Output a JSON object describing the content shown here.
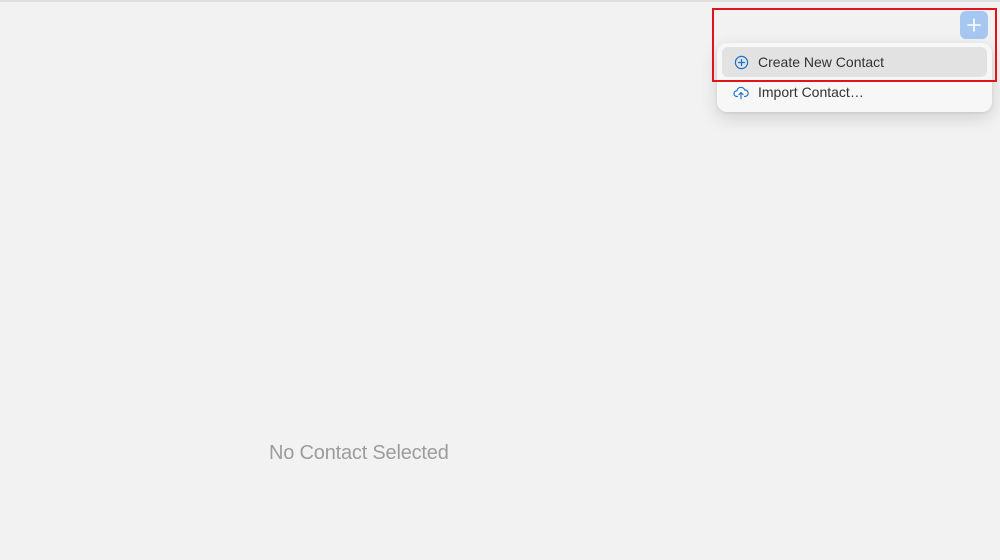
{
  "main": {
    "empty_state_text": "No Contact Selected"
  },
  "toolbar": {
    "add_icon": "plus-icon",
    "accent_color": "#a6c8f0"
  },
  "add_menu": {
    "items": [
      {
        "label": "Create New Contact",
        "icon": "plus-circle-icon",
        "highlighted": true
      },
      {
        "label": "Import Contact…",
        "icon": "cloud-upload-icon",
        "highlighted": false
      }
    ],
    "icon_color": "#1a73c9"
  },
  "annotation": {
    "highlight_color": "#e0141a"
  }
}
